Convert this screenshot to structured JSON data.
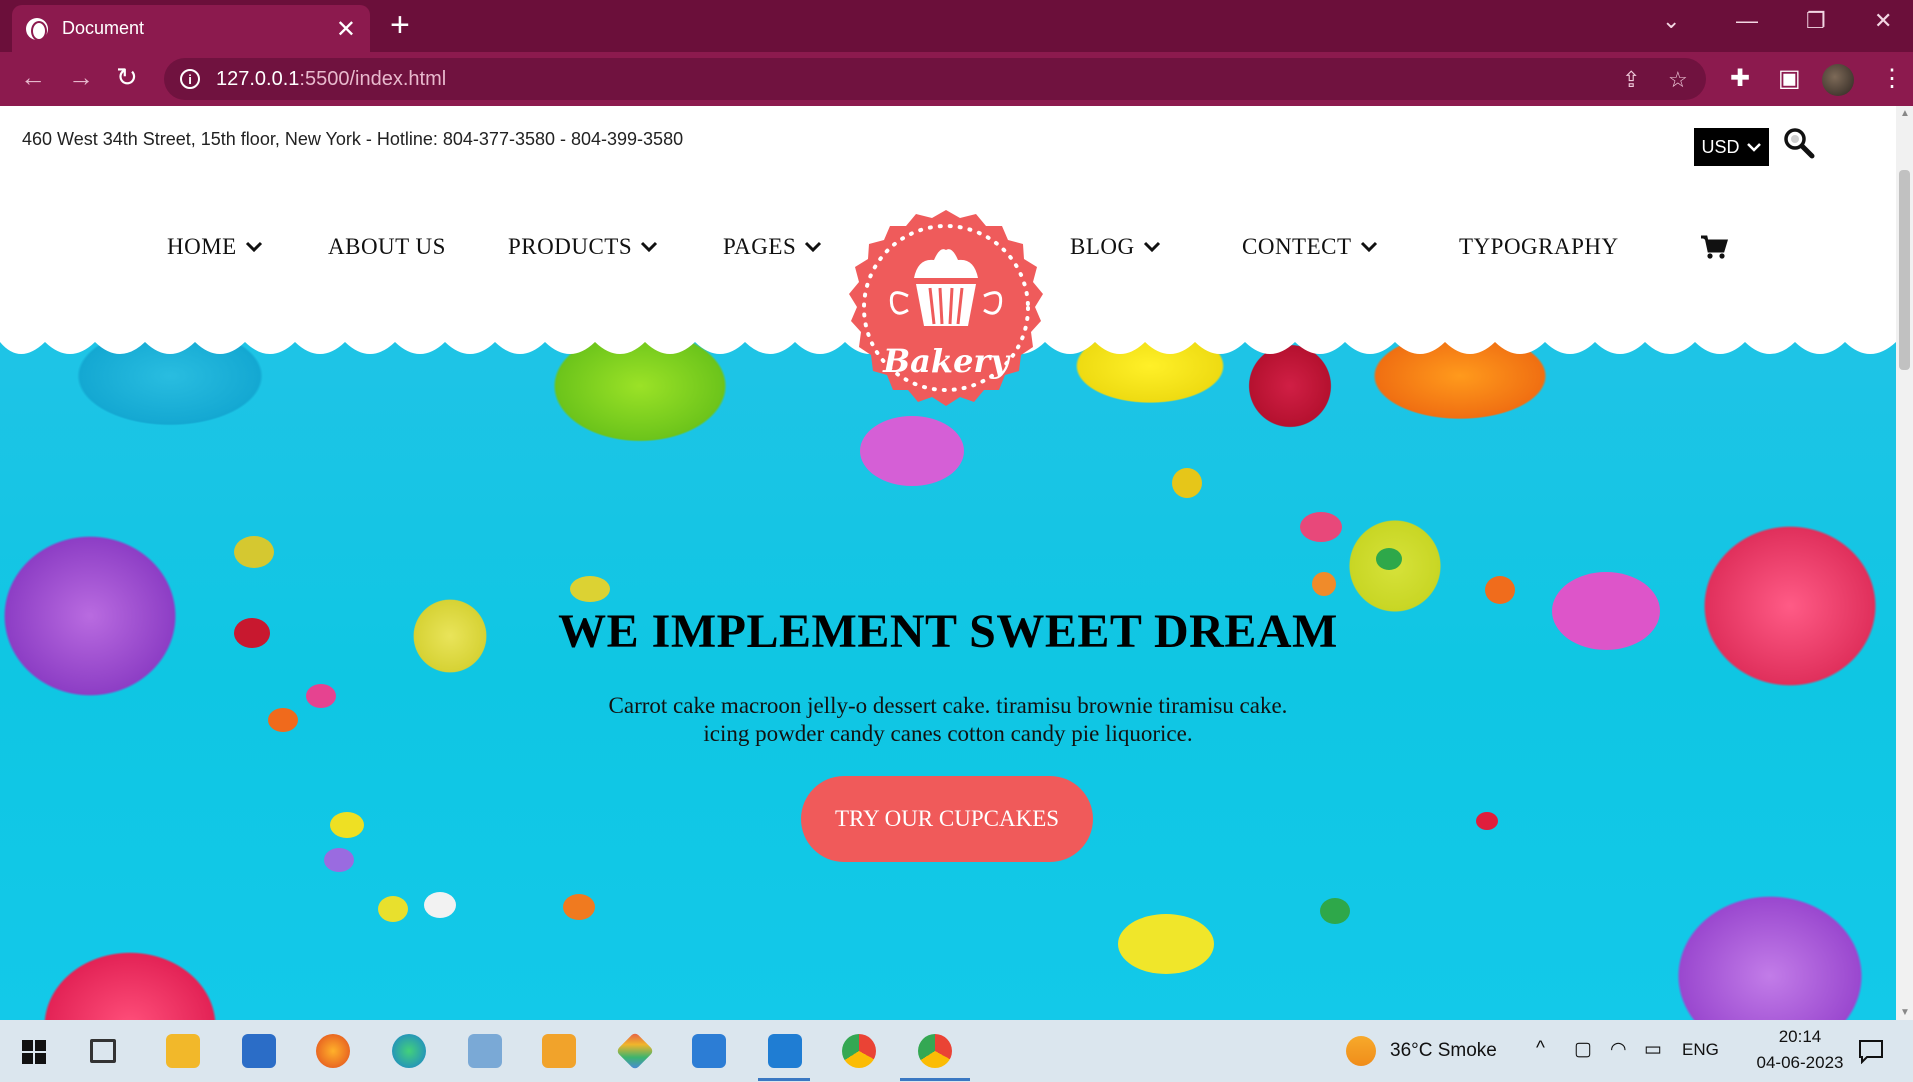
{
  "browser": {
    "tab_title": "Document",
    "url_host": "127.0.0.1",
    "url_path": ":5500/index.html"
  },
  "page": {
    "top_info": "460 West 34th Street, 15th floor, New York - Hotline: 804-377-3580 - 804-399-3580",
    "currency": "USD",
    "menu": {
      "home": "HOME",
      "about": "ABOUT US",
      "products": "PRODUCTS",
      "pages": "PAGES",
      "blog": "BLOG",
      "contect": "CONTECT",
      "typography": "TYPOGRAPHY"
    },
    "logo_text": "Bakery",
    "hero": {
      "title": "WE IMPLEMENT SWEET DREAM",
      "line1": "Carrot cake macroon jelly-o dessert cake. tiramisu brownie tiramisu cake.",
      "line2": "icing powder candy canes cotton candy pie liquorice.",
      "cta": "TRY OUR CUPCAKES"
    },
    "colors": {
      "accent": "#f05a5a",
      "chrome": "#8c1a4e",
      "hero_bg": "#13c9e9"
    }
  },
  "taskbar": {
    "weather": "36°C  Smoke",
    "language": "ENG",
    "time": "20:14",
    "date": "04-06-2023"
  }
}
